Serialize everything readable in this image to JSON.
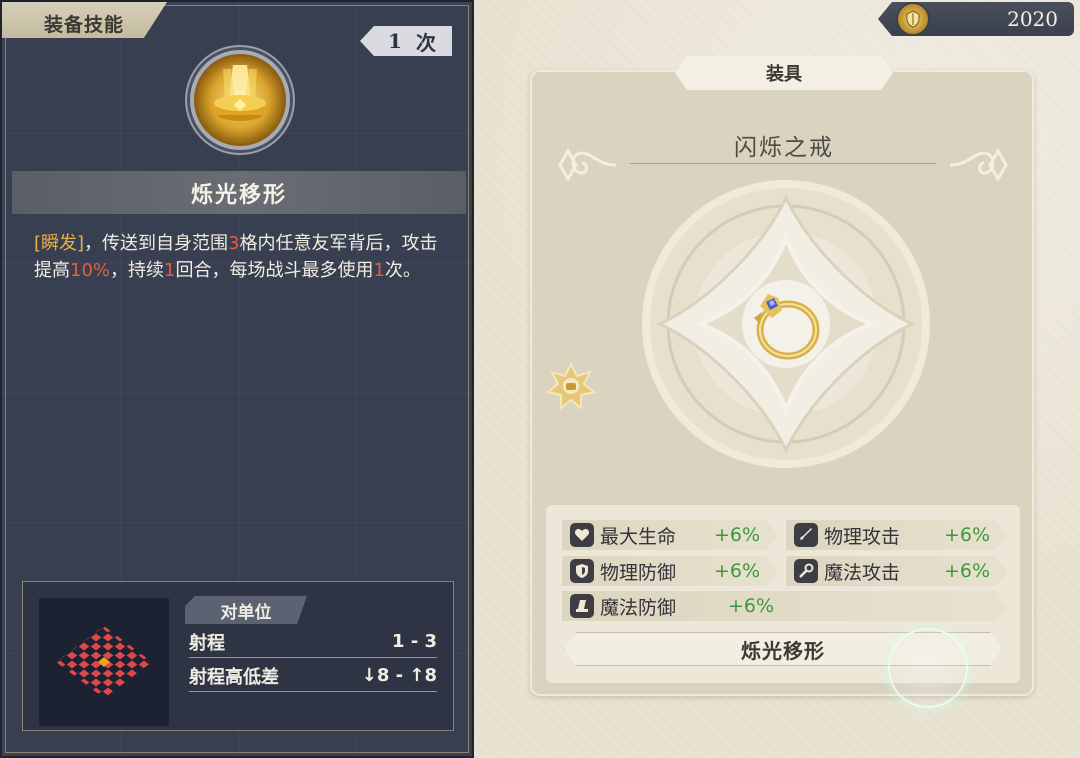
{
  "skill_panel": {
    "tab_label": "装备技能",
    "count_value": "1",
    "count_unit": "次",
    "skill_name": "烁光移形",
    "description": {
      "tag": "[瞬发]",
      "part1": "，传送到自身范围",
      "num1": "3",
      "part2": "格内任意友军背后，攻击提高",
      "num2": "10%",
      "part3": "，持续",
      "num3": "1",
      "part4": "回合，每场战斗最多使用",
      "num4": "1",
      "part5": "次。"
    },
    "target": {
      "label": "对单位",
      "range_label": "射程",
      "range_value": "1 - 3",
      "height_label": "射程高低差",
      "height_value": "↓8 - ↑8"
    }
  },
  "currency": {
    "icon": "coin-icon",
    "amount": "2020"
  },
  "equipment": {
    "header": "装具",
    "name": "闪烁之戒",
    "item_icon": "ring-icon",
    "stats": [
      {
        "icon": "heart-icon",
        "label": "最大生命",
        "value": "+6%"
      },
      {
        "icon": "sword-icon",
        "label": "物理攻击",
        "value": "+6%"
      },
      {
        "icon": "shield-icon",
        "label": "物理防御",
        "value": "+6%"
      },
      {
        "icon": "wand-icon",
        "label": "魔法攻击",
        "value": "+6%"
      },
      {
        "icon": "hat-icon",
        "label": "魔法防御",
        "value": "+6%"
      }
    ],
    "skill_button": "烁光移形"
  },
  "colors": {
    "panel_dark": "#383f50",
    "panel_light": "#d9d3bf",
    "highlight_orange": "#e2603e",
    "tag_gold": "#e8b24a",
    "stat_green": "#3c9a3c"
  }
}
